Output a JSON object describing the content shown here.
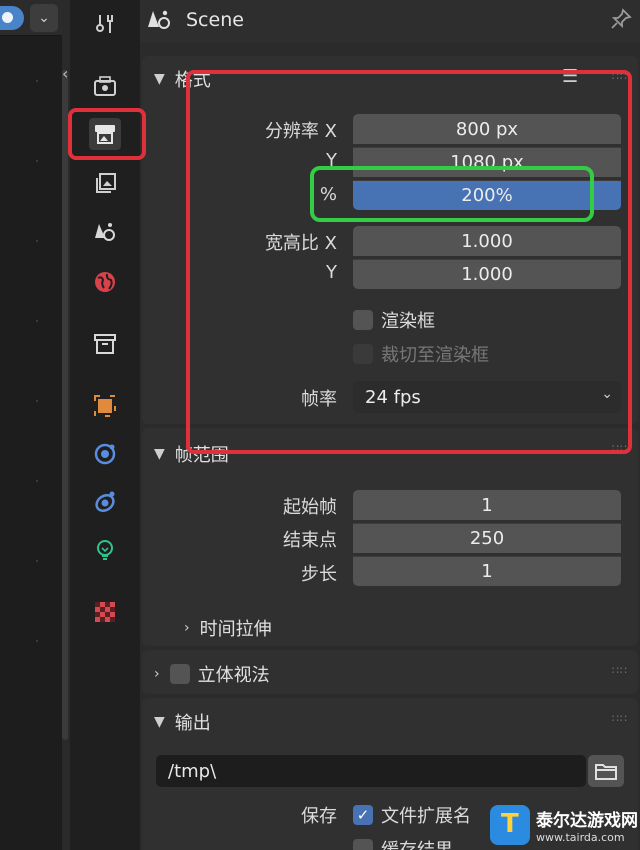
{
  "viewport": {
    "dropdown_glyph": "⌄"
  },
  "header": {
    "title": "Scene"
  },
  "format_panel": {
    "title": "格式",
    "res_x_label": "分辨率 X",
    "res_x": "800 px",
    "res_y_label": "Y",
    "res_y": "1080 px",
    "res_pct_label": "%",
    "res_pct": "200%",
    "aspect_x_label": "宽高比 X",
    "aspect_x": "1.000",
    "aspect_y_label": "Y",
    "aspect_y": "1.000",
    "render_region_label": "渲染框",
    "crop_label": "裁切至渲染框",
    "fps_label": "帧率",
    "fps_value": "24 fps"
  },
  "frame_range_panel": {
    "title": "帧范围",
    "start_label": "起始帧",
    "start": "1",
    "end_label": "结束点",
    "end": "250",
    "step_label": "步长",
    "step": "1",
    "time_stretch_label": "时间拉伸"
  },
  "stereo_panel": {
    "title": "立体视法"
  },
  "output_panel": {
    "title": "输出",
    "path": "/tmp\\",
    "save_label": "保存",
    "file_ext_label": "文件扩展名",
    "cache_label": "缓存结果"
  },
  "watermark": {
    "name": "泰尔达游戏网",
    "url": "www.tairda.com"
  },
  "colors": {
    "highlight_red": "#e0303a",
    "highlight_green": "#33cc44",
    "field_blue": "#4772b3"
  }
}
